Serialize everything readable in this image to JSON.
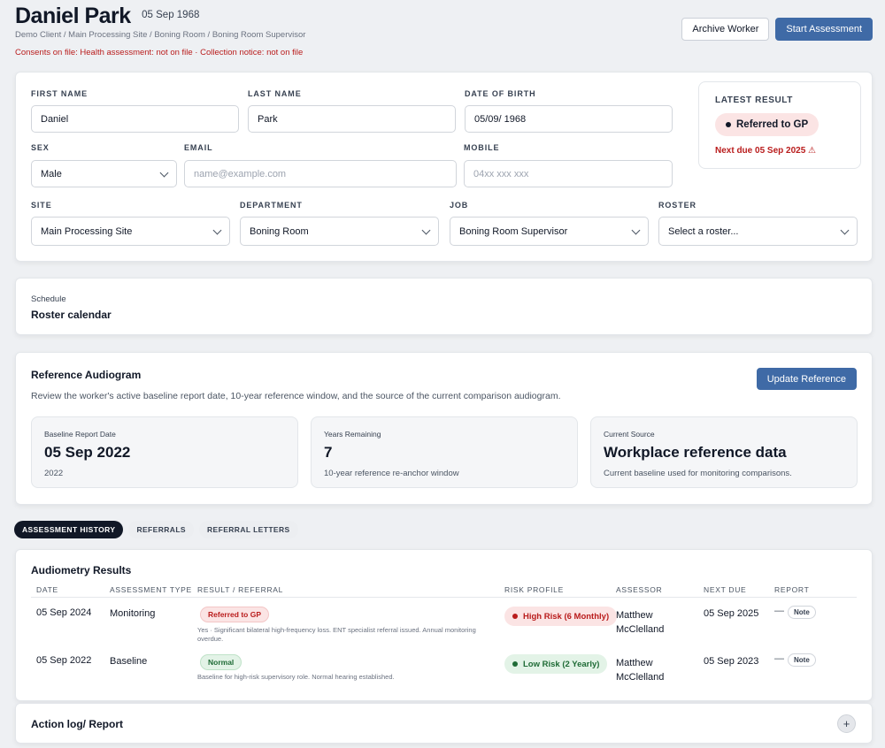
{
  "header": {
    "name": "Daniel Park",
    "dob": "05 Sep 1968",
    "breadcrumb": "Demo Client / Main Processing Site / Boning Room / Boning Room Supervisor",
    "consents": "Consents on file: Health assessment: not on file · Collection notice: not on file",
    "archive_label": "Archive Worker",
    "start_label": "Start Assessment"
  },
  "form": {
    "first_name_label": "FIRST NAME",
    "first_name": "Daniel",
    "last_name_label": "LAST NAME",
    "last_name": "Park",
    "dob_label": "DATE OF BIRTH",
    "dob_value": "05/09/ 1968",
    "sex_label": "SEX",
    "sex": "Male",
    "email_label": "EMAIL",
    "email_placeholder": "name@example.com",
    "mobile_label": "MOBILE",
    "mobile_placeholder": "04xx xxx xxx",
    "site_label": "SITE",
    "site": "Main Processing Site",
    "department_label": "DEPARTMENT",
    "department": "Boning Room",
    "job_label": "JOB",
    "job": "Boning Room Supervisor",
    "roster_label": "ROSTER",
    "roster": "Select a roster..."
  },
  "latest": {
    "title": "LATEST RESULT",
    "result": "Referred to GP",
    "next_due": "Next due 05 Sep 2025 ⚠"
  },
  "schedule": {
    "sub": "Schedule",
    "title": "Roster calendar"
  },
  "reference": {
    "title": "Reference Audiogram",
    "description": "Review the worker's active baseline report date, 10-year reference window, and the source of the current comparison audiogram.",
    "update_label": "Update Reference",
    "stats": [
      {
        "label": "Baseline Report Date",
        "value": "05 Sep 2022",
        "sub": "2022"
      },
      {
        "label": "Years Remaining",
        "value": "7",
        "sub": "10-year reference re-anchor window"
      },
      {
        "label": "Current Source",
        "value": "Workplace reference data",
        "sub": "Current baseline used for monitoring comparisons."
      }
    ]
  },
  "tabs": [
    "ASSESSMENT HISTORY",
    "REFERRALS",
    "REFERRAL LETTERS"
  ],
  "results": {
    "title": "Audiometry Results",
    "columns": [
      "DATE",
      "ASSESSMENT TYPE",
      "RESULT / REFERRAL",
      "RISK PROFILE",
      "ASSESSOR",
      "NEXT DUE",
      "REPORT"
    ],
    "rows": [
      {
        "date": "05 Sep 2024",
        "type": "Monitoring",
        "result": "Referred to GP",
        "result_tone": "red",
        "note": "Yes · Significant bilateral high-frequency loss. ENT specialist referral issued. Annual monitoring overdue.",
        "risk": "High Risk (6 Monthly)",
        "risk_tone": "red",
        "assessor_first": "Matthew",
        "assessor_last": "McClelland",
        "next_due": "05 Sep 2025",
        "dash": "—",
        "report": "Note"
      },
      {
        "date": "05 Sep 2022",
        "type": "Baseline",
        "result": "Normal",
        "result_tone": "green",
        "note": "Baseline for high-risk supervisory role. Normal hearing established.",
        "risk": "Low Risk (2 Yearly)",
        "risk_tone": "green",
        "assessor_first": "Matthew",
        "assessor_last": "McClelland",
        "next_due": "05 Sep 2023",
        "dash": "—",
        "report": "Note"
      }
    ]
  },
  "action_log": {
    "title": "Action log/ Report",
    "plus": "+"
  },
  "colors": {
    "primary": "#3f6aa6",
    "danger": "#b91c1c",
    "success": "#1f6b36",
    "dark": "#111827"
  }
}
